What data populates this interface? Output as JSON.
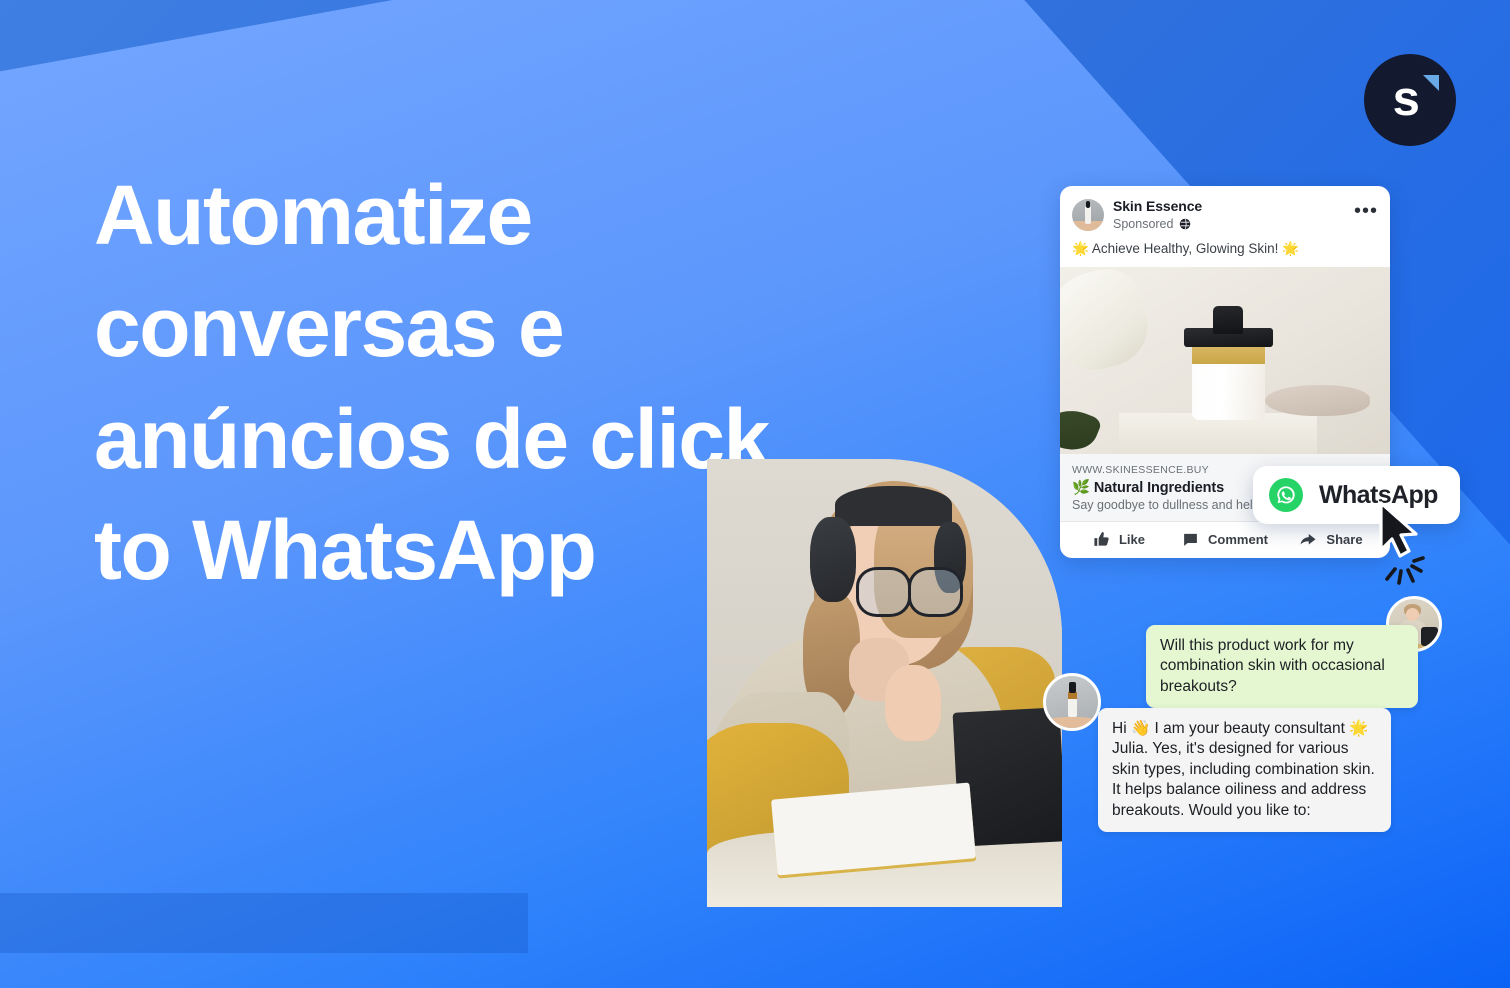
{
  "brand": {
    "logo_letter": "s",
    "logo_name": "brand-logo",
    "logo_bg": "#131a30",
    "logo_accent": "#6aa9e8"
  },
  "headline": {
    "text": "Automatize\nconversas e\nanúncios de click\nto WhatsApp"
  },
  "colors": {
    "bg_light": "#5c97fc",
    "bg_dark": "#3575dc",
    "bg_vivid": "#0b63f6",
    "whatsapp_green": "#25d366",
    "bubble_user": "#e4f7d0",
    "bubble_agent": "#f4f4f4"
  },
  "ad": {
    "brand_name": "Skin Essence",
    "sponsored_label": "Sponsored",
    "globe_icon": "globe-icon",
    "menu_icon": "more-options-icon",
    "caption": "🌟 Achieve Healthy, Glowing Skin! 🌟",
    "image_alt": "serum-dropper-bottle-photo",
    "url": "WWW.SKINESSENCE.BUY",
    "title": "🌿 Natural Ingredients",
    "description": "Say goodbye to dullness and hello to radiant, youthful skin.",
    "actions": [
      {
        "label": "Like",
        "icon": "thumbs-up-icon"
      },
      {
        "label": "Comment",
        "icon": "comment-icon"
      },
      {
        "label": "Share",
        "icon": "share-icon"
      }
    ]
  },
  "cta": {
    "label": "WhatsApp",
    "icon": "whatsapp-icon"
  },
  "chat": {
    "user_message": "Will this product work for my combination skin with occasional breakouts?",
    "agent_message": "Hi 👋 I am your beauty consultant 🌟Julia. Yes, it's designed for various skin types, including combination skin. It helps balance oiliness and address breakouts. Would you like to:"
  },
  "hero": {
    "photo_alt": "woman-with-headphones-writing-notes"
  }
}
